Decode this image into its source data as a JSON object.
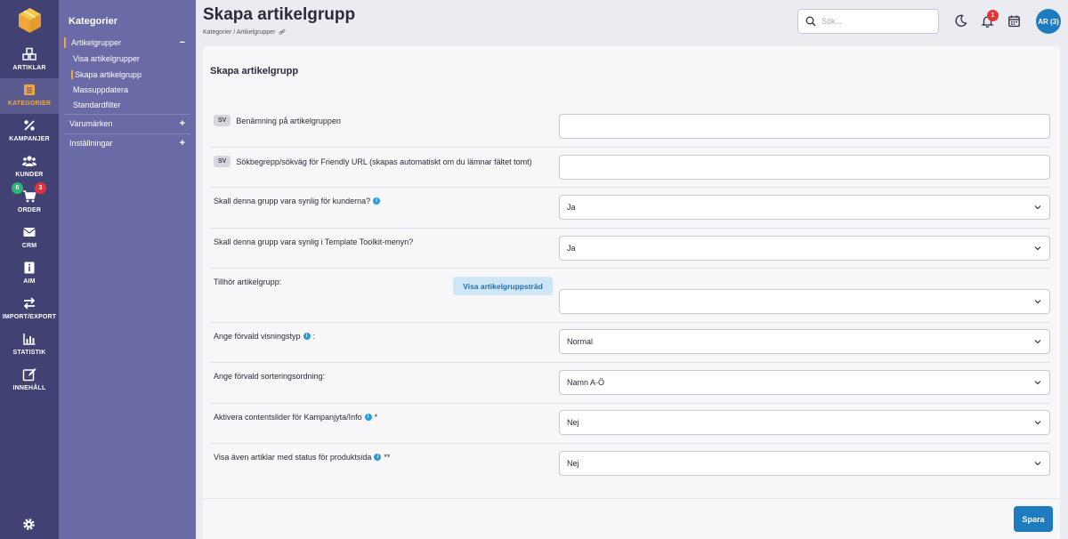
{
  "rail": {
    "items": [
      {
        "label": "ARTIKLAR",
        "icon": "boxes-icon"
      },
      {
        "label": "KATEGORIER",
        "icon": "list-icon"
      },
      {
        "label": "KAMPANJER",
        "icon": "percent-icon"
      },
      {
        "label": "KUNDER",
        "icon": "users-icon"
      },
      {
        "label": "ORDER",
        "icon": "cart-icon"
      },
      {
        "label": "CRM",
        "icon": "envelope-icon"
      },
      {
        "label": "AIM",
        "icon": "info-icon"
      },
      {
        "label": "IMPORT/EXPORT",
        "icon": "arrows-icon"
      },
      {
        "label": "STATISTIK",
        "icon": "bar-chart-icon"
      },
      {
        "label": "INNEHÅLL",
        "icon": "edit-icon"
      }
    ],
    "order_badge_green": "0",
    "order_badge_red": "3"
  },
  "subnav": {
    "title": "Kategorier",
    "groups": [
      {
        "label": "Artikelgrupper",
        "sign": "−"
      },
      {
        "label": "Varumärken",
        "sign": "+"
      },
      {
        "label": "Inställningar",
        "sign": "+"
      }
    ],
    "subitems": [
      "Visa artikelgrupper",
      "Skapa artikelgrupp",
      "Massuppdatera",
      "Standardfilter"
    ]
  },
  "header": {
    "title": "Skapa artikelgrupp",
    "breadcrumb": "Kategorier / Artikelgrupper",
    "search_placeholder": "Sök...",
    "notif_count": "1",
    "avatar": "AR (3)"
  },
  "form": {
    "title": "Skapa artikelgrupp",
    "lang": "SV",
    "fields": [
      {
        "label": "Benämning på artikelgruppen",
        "value": ""
      },
      {
        "label": "Sökbegrepp/sökväg för Friendly URL (skapas automatiskt om du lämnar fältet tomt)",
        "value": ""
      },
      {
        "label": "Skall denna grupp vara synlig för kunderna?",
        "value": "Ja"
      },
      {
        "label": "Skall denna grupp vara synlig i Template Toolkit-menyn?",
        "value": "Ja"
      },
      {
        "label": "Tillhör artikelgrupp:",
        "value": ""
      },
      {
        "label": "Ange förvald visningstyp",
        "suffix": ":",
        "value": "Normal"
      },
      {
        "label": "Ange förvald sorteringsordning:",
        "value": "Namn A-Ö"
      },
      {
        "label": "Aktivera contentslider för Kampanjyta/Info",
        "suffix": "*",
        "value": "Nej"
      },
      {
        "label": "Visa även artiklar med status för produktsida",
        "suffix": "**",
        "value": "Nej"
      }
    ],
    "tree_button": "Visa artikelgruppsträd",
    "info_glyph": "i",
    "save_button": "Spara"
  }
}
